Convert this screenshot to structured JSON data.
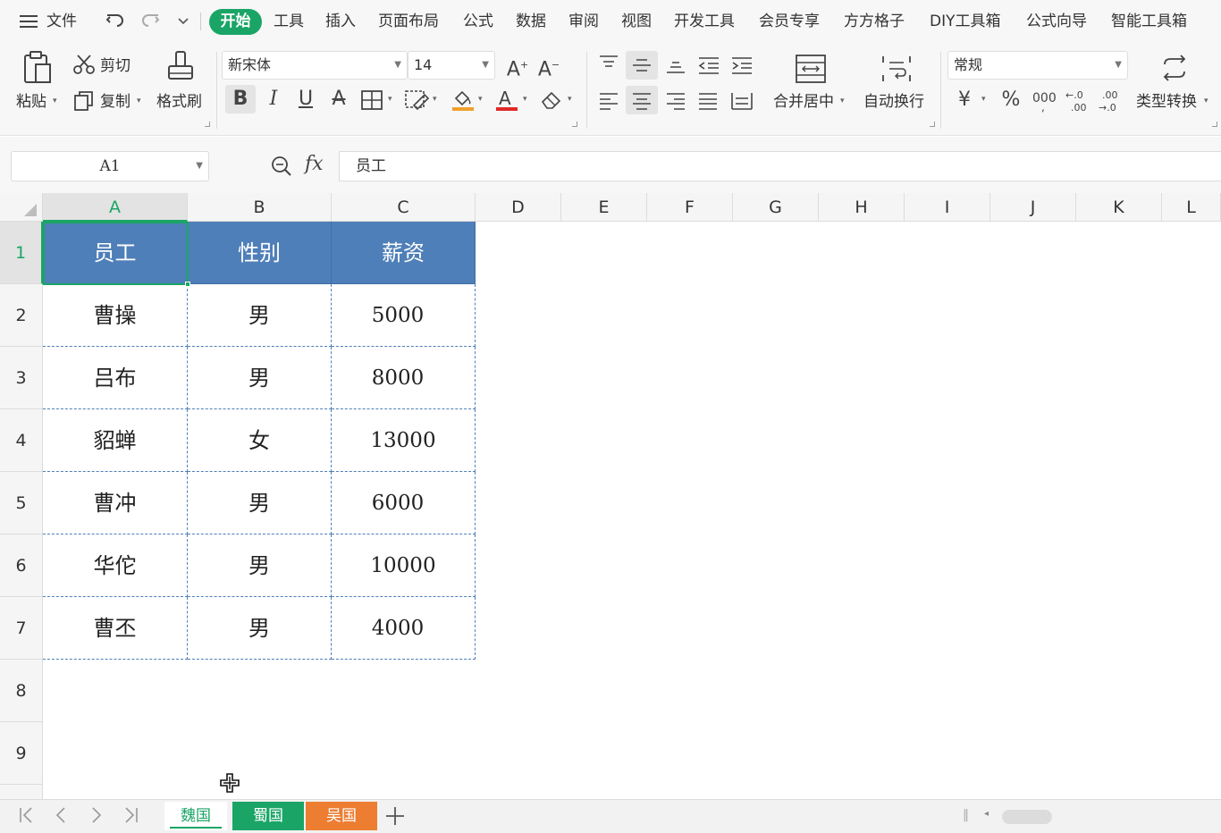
{
  "menubar": {
    "file_label": "文件",
    "tabs": [
      "开始",
      "工具",
      "插入",
      "页面布局",
      "公式",
      "数据",
      "审阅",
      "视图",
      "开发工具",
      "会员专享",
      "方方格子",
      "DIY工具箱",
      "公式向导",
      "智能工具箱"
    ]
  },
  "ribbon": {
    "paste": "粘贴",
    "cut": "剪切",
    "copy": "复制",
    "format_painter": "格式刷",
    "font_name": "新宋体",
    "font_size": "14",
    "merge_center": "合并居中",
    "wrap_text": "自动换行",
    "number_format": "常规",
    "type_convert": "类型转换",
    "currency_symbol": "¥",
    "percent_symbol": "%"
  },
  "formula_bar": {
    "name_box": "A1",
    "fx_symbol": "fx",
    "content": "员工"
  },
  "grid": {
    "columns": [
      "A",
      "B",
      "C",
      "D",
      "E",
      "F",
      "G",
      "H",
      "I",
      "J",
      "K",
      "L"
    ],
    "rows": [
      "1",
      "2",
      "3",
      "4",
      "5",
      "6",
      "7",
      "8",
      "9"
    ],
    "selected_cell": "A1",
    "table": {
      "headers": [
        "员工",
        "性别",
        "薪资"
      ],
      "rows": [
        [
          "曹操",
          "男",
          "5000"
        ],
        [
          "吕布",
          "男",
          "8000"
        ],
        [
          "貂蝉",
          "女",
          "13000"
        ],
        [
          "曹冲",
          "男",
          "6000"
        ],
        [
          "华佗",
          "男",
          "10000"
        ],
        [
          "曹丕",
          "男",
          "4000"
        ]
      ]
    }
  },
  "sheets": [
    {
      "name": "魏国",
      "state": "active"
    },
    {
      "name": "蜀国",
      "color": "#1aa566"
    },
    {
      "name": "吴国",
      "color": "#ed7d31"
    }
  ],
  "colors": {
    "accent": "#1aa566",
    "table_header": "#4f7fb8",
    "sheet_orange": "#ed7d31"
  }
}
